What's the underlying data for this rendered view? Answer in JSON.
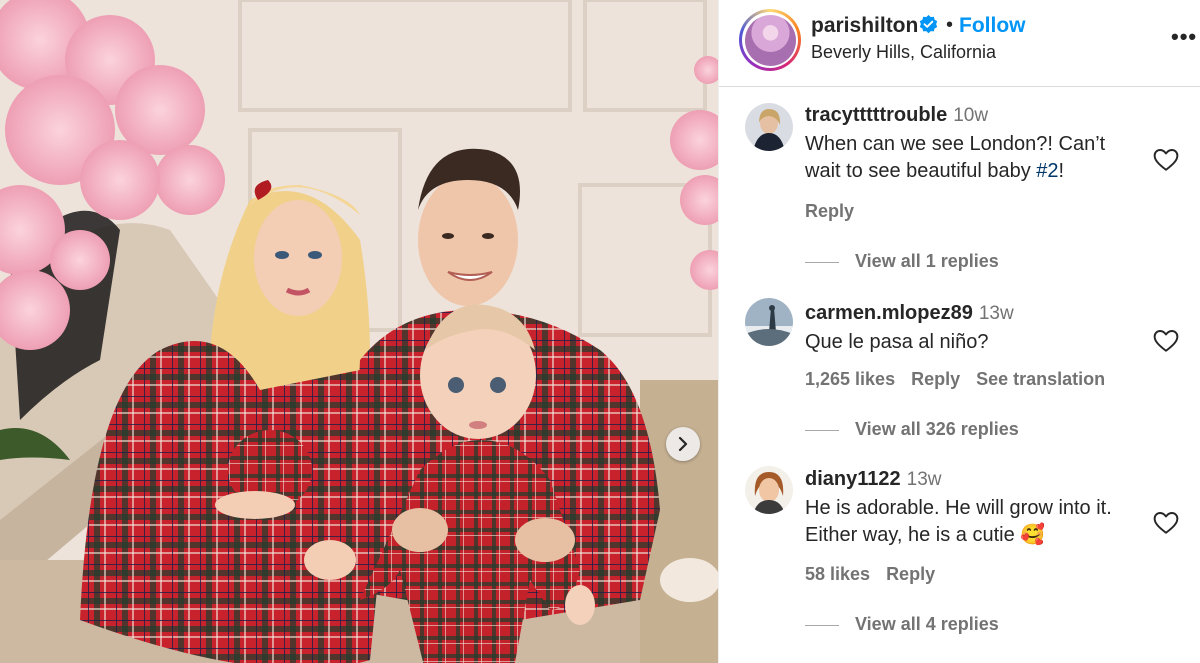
{
  "post": {
    "username": "parishilton",
    "separator": "•",
    "follow_label": "Follow",
    "location": "Beverly Hills, California",
    "more_label": "•••"
  },
  "comments": [
    {
      "user": "tracytttttrouble",
      "time": "10w",
      "text_before": "When can we see London?! Can’t wait to see beautiful baby ",
      "hashtag": "#2",
      "text_after": "!",
      "reply_label": "Reply",
      "view_replies": "View all 1 replies"
    },
    {
      "user": "carmen.mlopez89",
      "time": "13w",
      "text": "Que le pasa al niño?",
      "likes": "1,265 likes",
      "reply_label": "Reply",
      "translate_label": "See translation",
      "view_replies": "View all 326 replies"
    },
    {
      "user": "diany1122",
      "time": "13w",
      "text": "He is adorable. He will grow into it. Either way, he is a cutie ",
      "emoji": "🥰",
      "likes": "58 likes",
      "reply_label": "Reply",
      "view_replies": "View all 4 replies"
    }
  ],
  "icons": {
    "verified": "verified-badge-icon",
    "heart": "heart-outline-icon",
    "next": "chevron-right-icon",
    "more": "more-options-icon"
  },
  "colors": {
    "follow": "#0095f6",
    "verified": "#0095f6",
    "secondary_text": "#737373",
    "hashtag": "#00376b"
  }
}
